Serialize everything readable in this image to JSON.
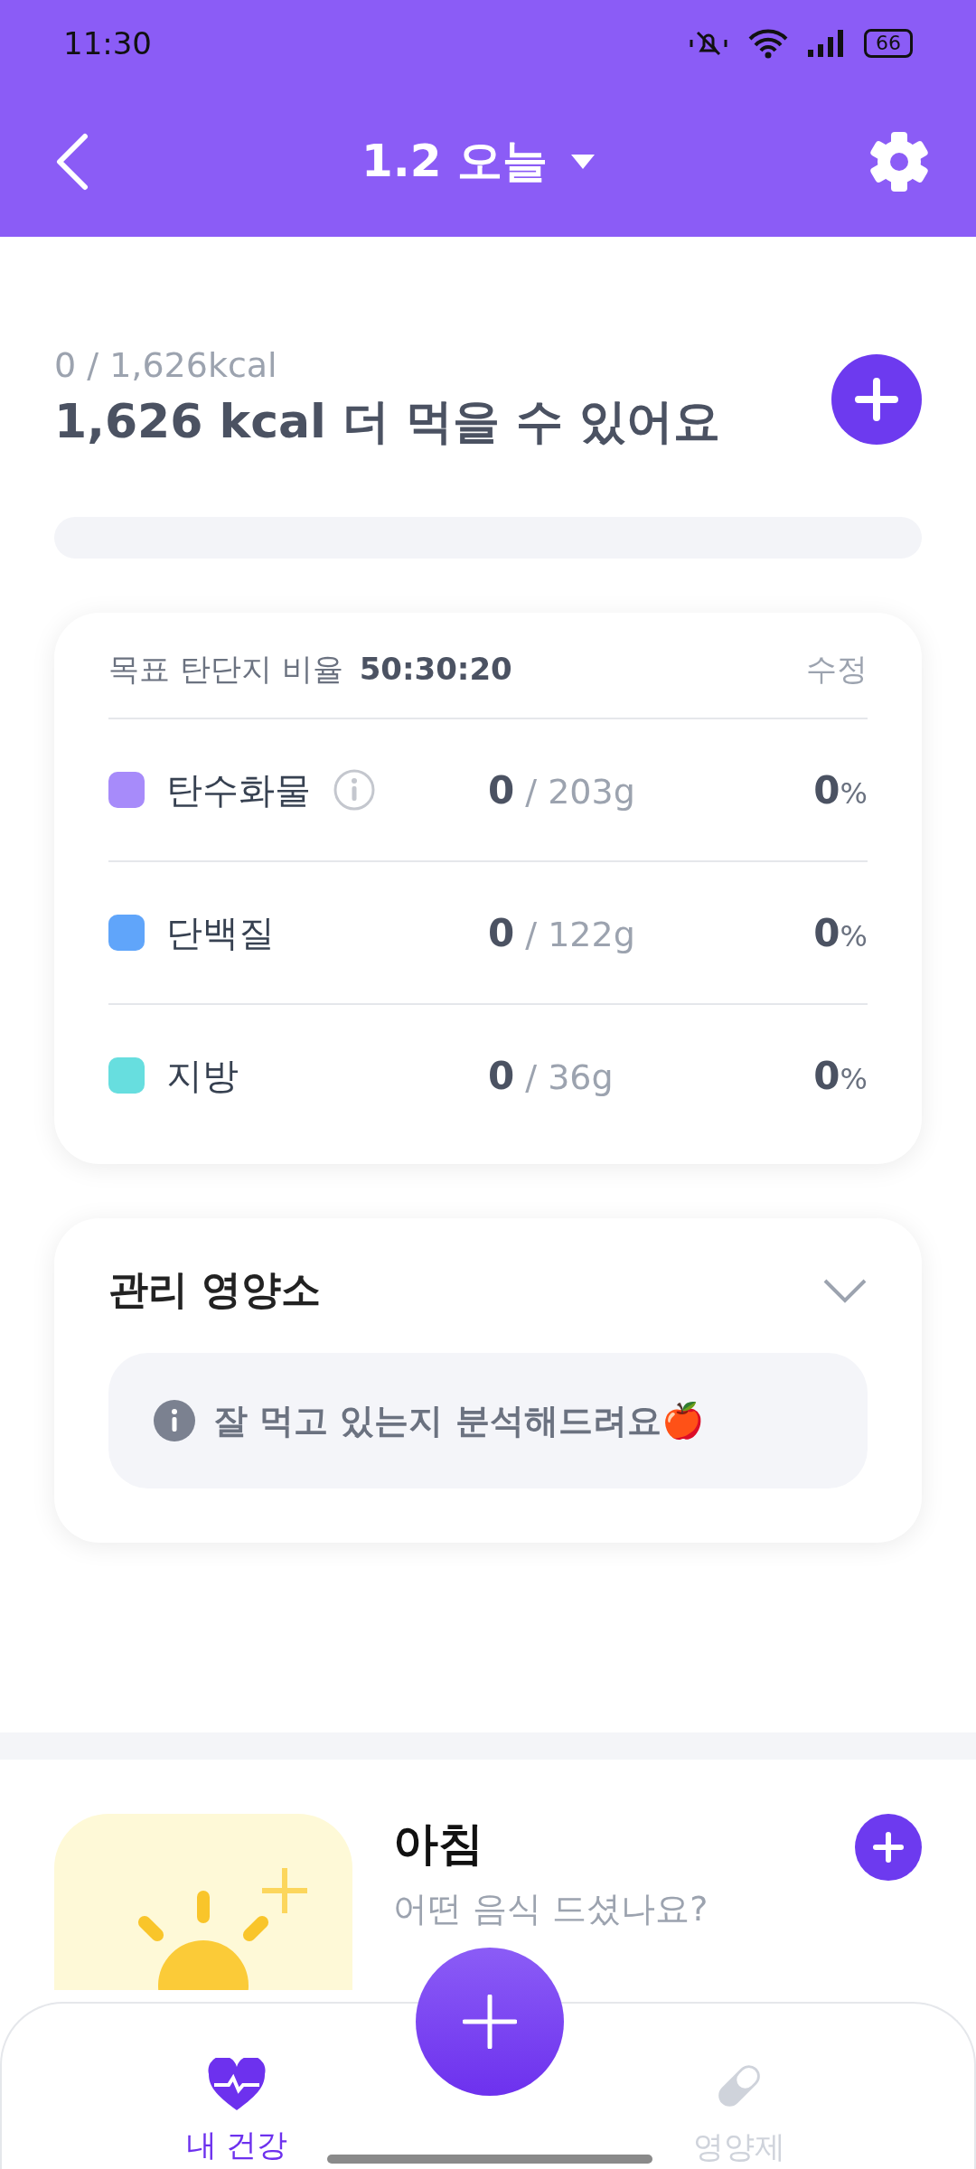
{
  "status_bar": {
    "time": "11:30",
    "battery": "66"
  },
  "header": {
    "title": "1.2 오늘"
  },
  "summary": {
    "consumed": "0 / 1,626kcal",
    "headline": "1,626 kcal 더 먹을 수 있어요",
    "level": 0
  },
  "macros": {
    "label": "목표 탄단지 비율",
    "ratio": "50:30:20",
    "edit": "수정",
    "rows": [
      {
        "name": "탄수화물",
        "color": "#a78bfa",
        "info": true,
        "amount": "0",
        "target": "/ 203g",
        "percent": "0",
        "unit": "%"
      },
      {
        "name": "단백질",
        "color": "#60a5fa",
        "info": false,
        "amount": "0",
        "target": "/ 122g",
        "percent": "0",
        "unit": "%"
      },
      {
        "name": "지방",
        "color": "#67dedf",
        "info": false,
        "amount": "0",
        "target": "/ 36g",
        "percent": "0",
        "unit": "%"
      }
    ]
  },
  "nutrients": {
    "title": "관리 영양소",
    "notice": "잘 먹고 있는지 분석해드려요🍎"
  },
  "meals": [
    {
      "title": "아침",
      "subtitle": "어떤 음식 드셨나요?"
    }
  ],
  "bottom_nav": {
    "items": [
      {
        "label": "내 건강",
        "kind": "heart",
        "selected": true
      },
      {
        "label": "영양제",
        "kind": "pill",
        "selected": false
      }
    ]
  }
}
